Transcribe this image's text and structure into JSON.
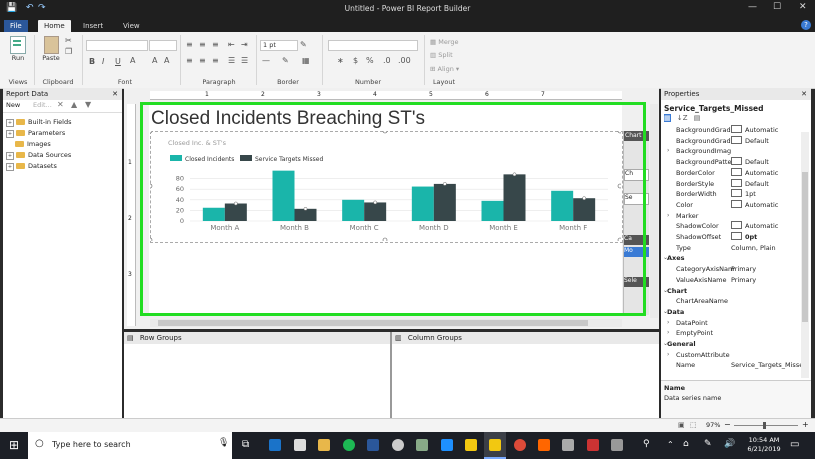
{
  "window": {
    "title": "Untitled - Power BI Report Builder",
    "minimize": "—",
    "maximize": "☐",
    "close": "✕"
  },
  "quick_access": {
    "save": "💾",
    "undo": "↶",
    "redo": "↷"
  },
  "tabs": [
    {
      "label": "File"
    },
    {
      "label": "Home"
    },
    {
      "label": "Insert"
    },
    {
      "label": "View"
    }
  ],
  "help": "?",
  "ribbon": {
    "groups": {
      "views": "Views",
      "clipboard": "Clipboard",
      "font": "Font",
      "paragraph": "Paragraph",
      "border": "Border",
      "number": "Number",
      "layout": "Layout"
    },
    "run_label": "Run",
    "paste_label": "Paste",
    "border_width": "1 pt",
    "merge": "Merge",
    "split": "Split",
    "align": "Align",
    "bold": "B",
    "italic": "I",
    "underline": "U",
    "currency": "$",
    "percent": "%"
  },
  "report_data": {
    "title": "Report Data",
    "close": "✕",
    "new_label": "New",
    "edit_label": "Edit...",
    "items": [
      {
        "label": "Built-in Fields"
      },
      {
        "label": "Parameters"
      },
      {
        "label": "Images"
      },
      {
        "label": "Data Sources"
      },
      {
        "label": "Datasets"
      }
    ]
  },
  "report": {
    "title": "Closed Incidents Breaching ST's",
    "ruler_numbers": [
      "1",
      "2",
      "3",
      "4",
      "5",
      "6",
      "7"
    ],
    "ruler_left_numbers": [
      "1",
      "2",
      "3"
    ]
  },
  "chart_data": {
    "type": "bar",
    "title": "Closed Inc. & ST's",
    "categories": [
      "Month A",
      "Month B",
      "Month C",
      "Month D",
      "Month E",
      "Month F"
    ],
    "series": [
      {
        "name": "Closed Incidents",
        "color": "#1ab5aa",
        "values": [
          25,
          95,
          40,
          65,
          38,
          57
        ]
      },
      {
        "name": "Service Targets Missed",
        "color": "#37474a",
        "values": [
          33,
          23,
          35,
          70,
          88,
          43
        ]
      }
    ],
    "yticks": [
      "0",
      "20",
      "40",
      "60",
      "80"
    ],
    "ylim": [
      0,
      100
    ],
    "legend_position": "top-left",
    "grid": true
  },
  "side_panel": {
    "chart_label": "Chart",
    "items": [
      "Ch",
      "Se",
      "Ca",
      "Mo"
    ],
    "sel": "Sele"
  },
  "groups": {
    "row": "Row Groups",
    "column": "Column Groups"
  },
  "properties": {
    "title": "Properties",
    "close": "✕",
    "selected": "Service_Targets_Missed",
    "rows": [
      {
        "name": "BackgroundGrad",
        "value": "Automatic",
        "swatch": true
      },
      {
        "name": "BackgroundGrad",
        "value": "Default",
        "swatch": true
      },
      {
        "name": "BackgroundImag",
        "value": "",
        "arrow": "›"
      },
      {
        "name": "BackgroundPatte",
        "value": "Default",
        "swatch": true
      },
      {
        "name": "BorderColor",
        "value": "Automatic",
        "swatch": true
      },
      {
        "name": "BorderStyle",
        "value": "Default",
        "swatch": true
      },
      {
        "name": "BorderWidth",
        "value": "1pt",
        "swatch": true
      },
      {
        "name": "Color",
        "value": "Automatic",
        "swatch": true
      },
      {
        "name": "Marker",
        "value": "",
        "arrow": "›"
      },
      {
        "name": "ShadowColor",
        "value": "Automatic",
        "swatch": true
      },
      {
        "name": "ShadowOffset",
        "value": "0pt",
        "swatch": true
      },
      {
        "name": "Type",
        "value": "Column, Plain"
      },
      {
        "name": "Axes",
        "value": "",
        "cat": true
      },
      {
        "name": "CategoryAxisNam",
        "value": "Primary"
      },
      {
        "name": "ValueAxisName",
        "value": "Primary"
      },
      {
        "name": "Chart",
        "value": "",
        "cat": true
      },
      {
        "name": "ChartAreaName",
        "value": ""
      },
      {
        "name": "Data",
        "value": "",
        "cat": true
      },
      {
        "name": "DataPoint",
        "value": "",
        "arrow": "›"
      },
      {
        "name": "EmptyPoint",
        "value": "",
        "arrow": "›"
      },
      {
        "name": "General",
        "value": "",
        "cat": true
      },
      {
        "name": "CustomAttribute",
        "value": "",
        "arrow": "›"
      },
      {
        "name": "Name",
        "value": "Service_Targets_Misse"
      }
    ],
    "desc_title": "Name",
    "desc_text": "Data series name"
  },
  "status": {
    "zoom": "97%"
  },
  "taskbar": {
    "search_placeholder": "Type here to search",
    "time": "10:54 AM",
    "date": "6/21/2019"
  }
}
